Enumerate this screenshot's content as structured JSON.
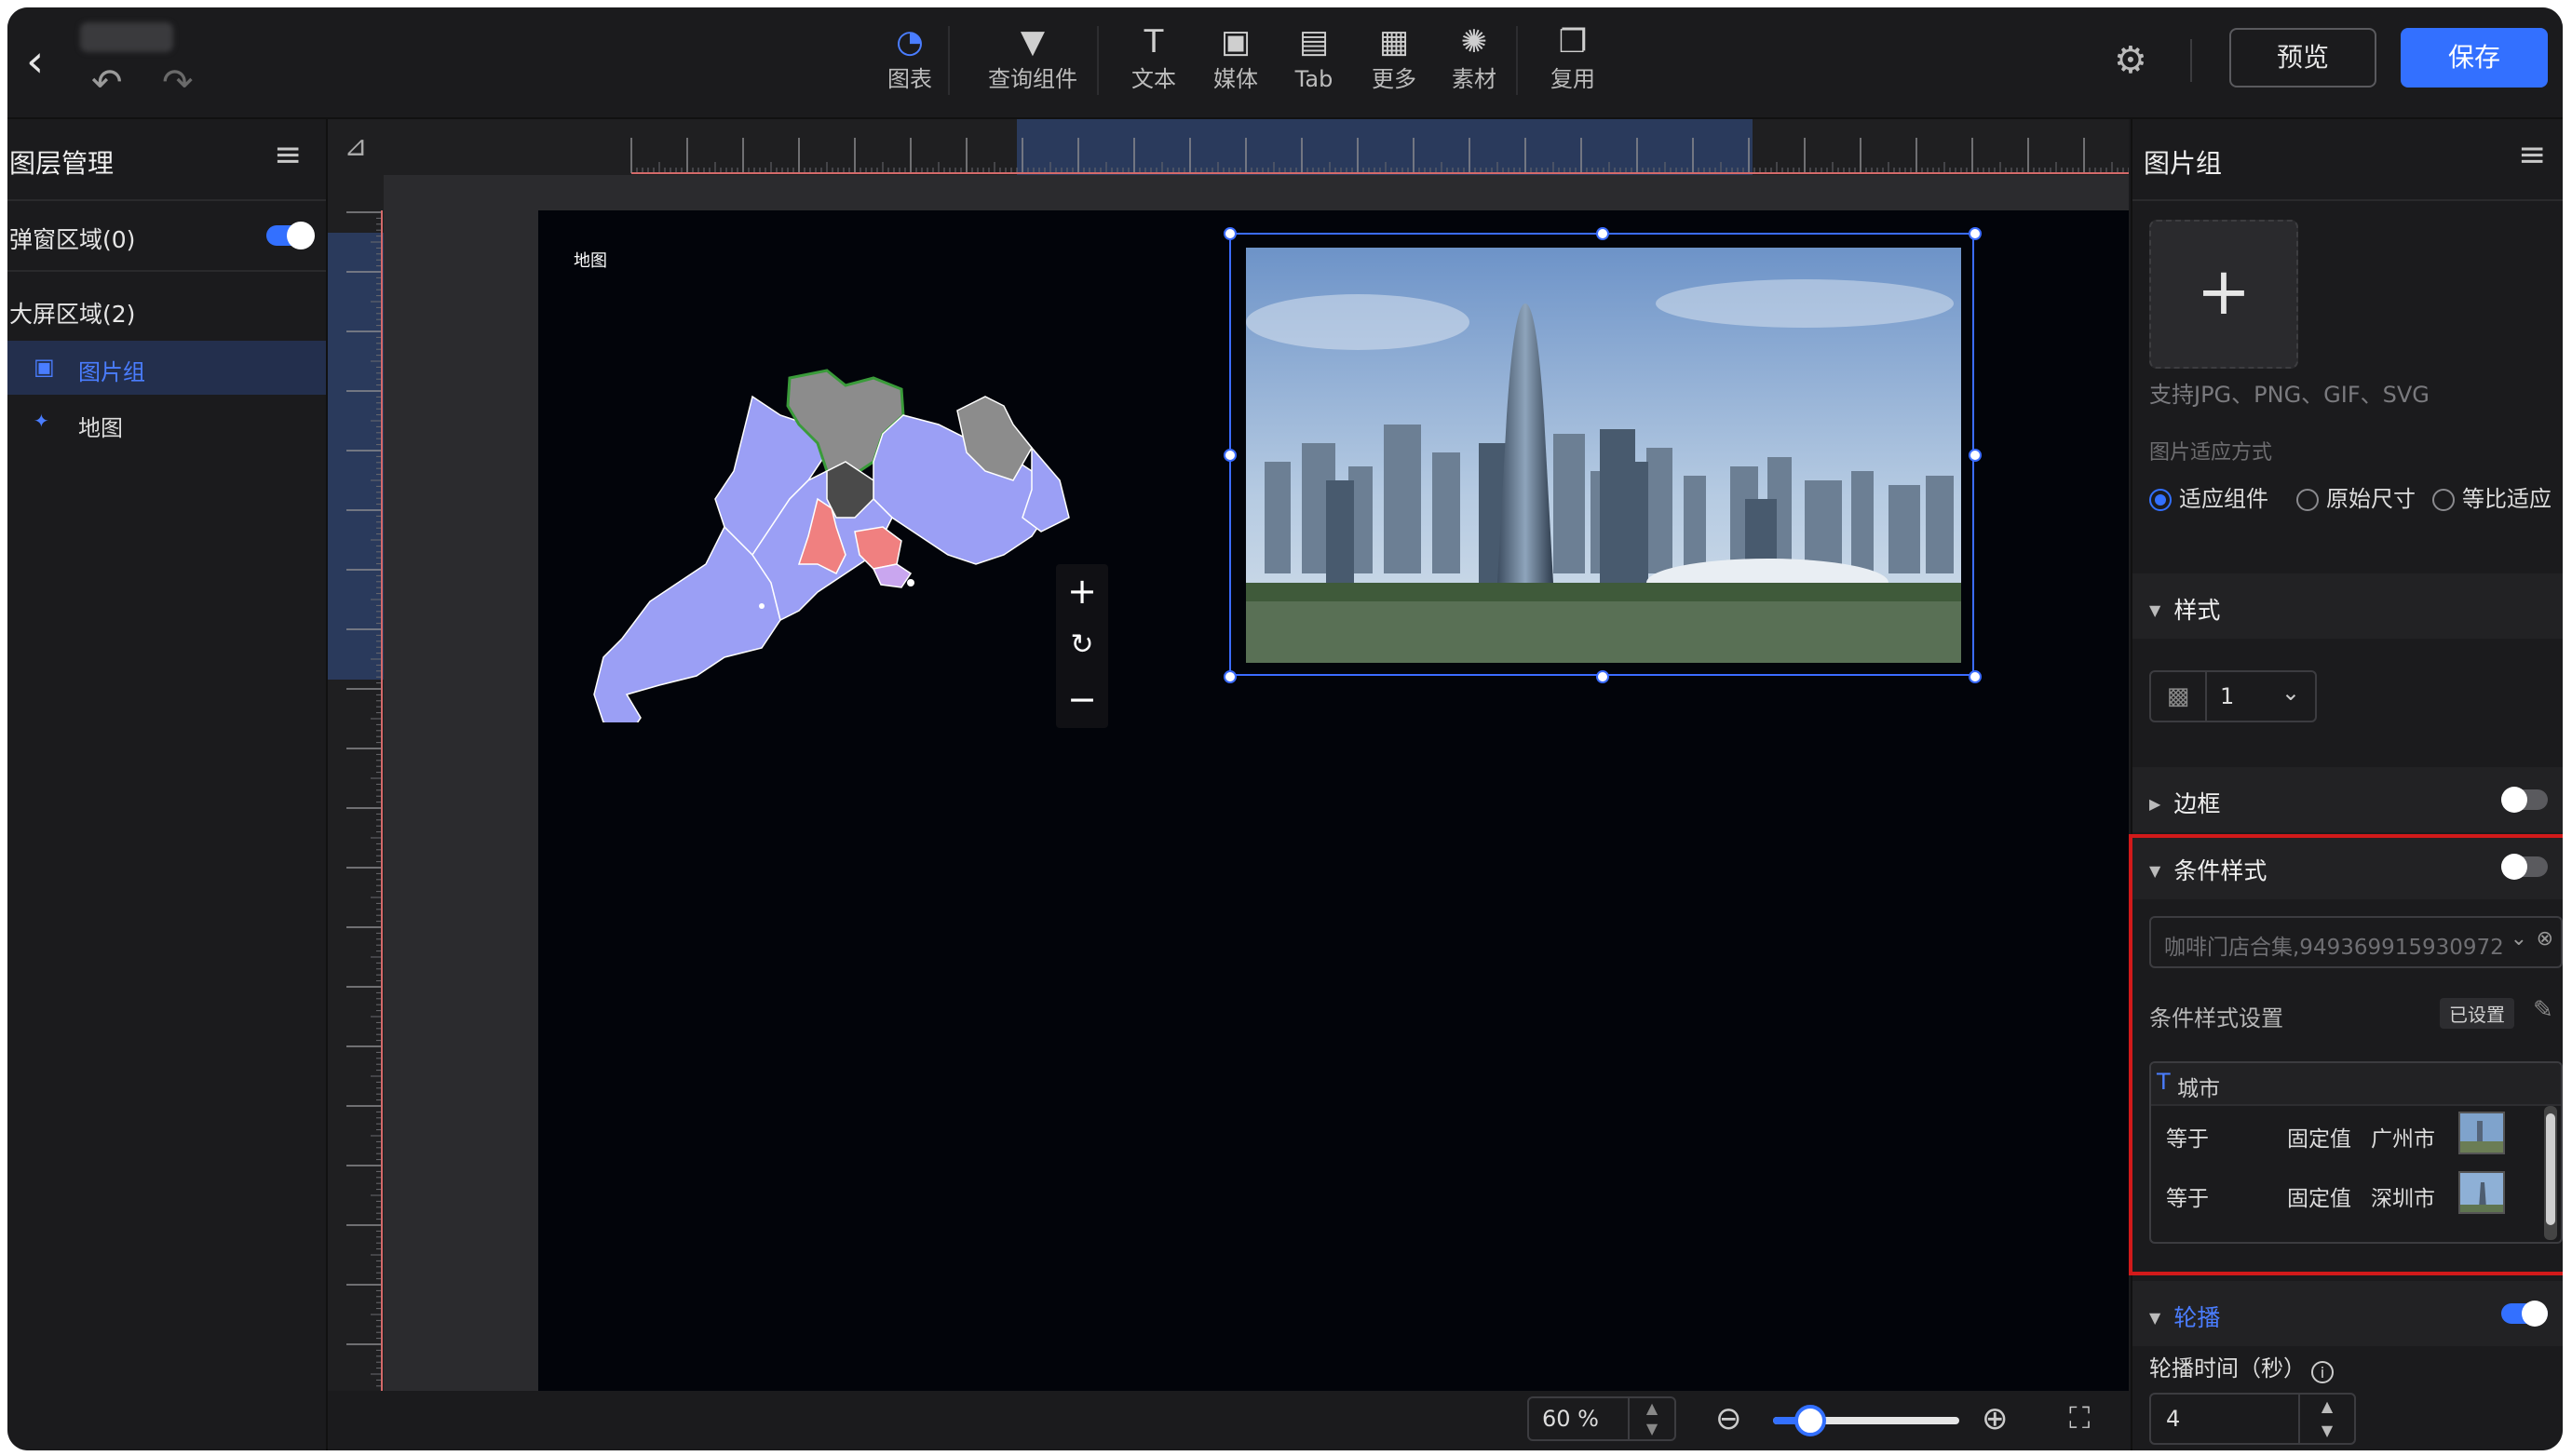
{
  "topbar": {
    "back_glyph": "‹",
    "undo_glyph": "↶",
    "redo_glyph": "↷",
    "tools": [
      {
        "label": "图表",
        "icon": "pie-chart-icon",
        "glyph": "◔"
      },
      {
        "label": "查询组件",
        "icon": "filter-icon",
        "glyph": "▼"
      },
      {
        "label": "文本",
        "icon": "text-icon",
        "glyph": "T"
      },
      {
        "label": "媒体",
        "icon": "image-icon",
        "glyph": "▣"
      },
      {
        "label": "Tab",
        "icon": "tab-icon",
        "glyph": "▤"
      },
      {
        "label": "更多",
        "icon": "grid-icon",
        "glyph": "▦"
      },
      {
        "label": "素材",
        "icon": "palette-icon",
        "glyph": "✺"
      },
      {
        "label": "复用",
        "icon": "copy-icon",
        "glyph": "❐"
      }
    ],
    "settings_glyph": "⚙",
    "preview": "预览",
    "save": "保存"
  },
  "left_panel": {
    "title": "图层管理",
    "menu_glyph": "≡",
    "popup_area": "弹窗区域(0)",
    "screen_area": "大屏区域(2)",
    "layers": [
      {
        "name": "图片组",
        "icon": "image-group-icon",
        "glyph": "▣",
        "active": true
      },
      {
        "name": "地图",
        "icon": "map-icon",
        "glyph": "✦",
        "active": false
      }
    ]
  },
  "canvas": {
    "map_title": "地图",
    "map_controls": [
      "+",
      "↻",
      "−"
    ],
    "ruler_corner_glyph": "⊿"
  },
  "bottom_bar": {
    "zoom": "60 %",
    "zoom_up": "▲",
    "zoom_down": "▼",
    "zoom_out_glyph": "⊖",
    "zoom_in_glyph": "⊕",
    "fit_glyph": "⛶",
    "zoom_level": 0.2
  },
  "right_panel": {
    "title": "图片组",
    "menu_glyph": "≡",
    "upload_glyph": "+",
    "upload_hint": "支持JPG、PNG、GIF、SVG",
    "fit_mode_label": "图片适应方式",
    "fit_options": [
      "适应组件",
      "原始尺寸",
      "等比适应"
    ],
    "fit_selected": 0,
    "style_section": "样式",
    "style_value": "1",
    "style_pattern_glyph": "▩",
    "chevron_glyph": "⌄",
    "border_section": "边框",
    "conditional_section": "条件样式",
    "dataset": "咖啡门店合集,949369915930972",
    "clear_glyph": "⊗",
    "conditional_setting_label": "条件样式设置",
    "configured": "已设置",
    "edit_glyph": "✎",
    "field_type": "T",
    "field_name": "城市",
    "conditions": [
      {
        "operator": "等于",
        "type": "固定值",
        "value": "广州市"
      },
      {
        "operator": "等于",
        "type": "固定值",
        "value": "深圳市"
      }
    ],
    "carousel_section": "轮播",
    "carousel_time_label": "轮播时间（秒）",
    "info_glyph": "i",
    "carousel_time": "4",
    "section_arrow_open": "▼",
    "section_arrow_closed": "▶"
  },
  "colors": {
    "accent": "#3370ff",
    "highlight_box": "#d21a1a",
    "map_fill": "#9b9ff5",
    "map_gray": "#8c8c8c",
    "map_red": "#f08080"
  }
}
